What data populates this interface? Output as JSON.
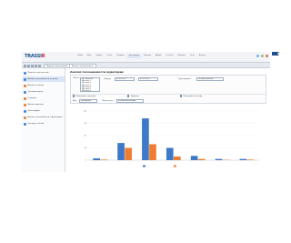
{
  "app": {
    "logo_main": "TRASSI",
    "logo_accent": "R",
    "menu": [
      "Файл",
      "Вид",
      "Сервис",
      "Окна",
      "Справка",
      "Настройки",
      "Каналы",
      "Архив",
      "Отчёты",
      "Помощь",
      "Сеть",
      "Выход"
    ],
    "menu_selected_index": 5
  },
  "tabs": {
    "items": [
      "Подсчёт посетителей",
      "Анализ посещаемости"
    ],
    "active_index": 1
  },
  "sidebar": {
    "items": [
      {
        "label": "Подсчёт посетителей",
        "color": "#3c7dd9"
      },
      {
        "label": "Анализ посещаемости по дням",
        "color": "#3c7dd9"
      },
      {
        "label": "Анализ по часам",
        "color": "#e07b2a"
      },
      {
        "label": "Тепловая карта",
        "color": "#3c7dd9"
      },
      {
        "label": "Очереди",
        "color": "#e07b2a"
      },
      {
        "label": "Анализ времени",
        "color": "#e07b2a"
      },
      {
        "label": "Демография",
        "color": "#3c7dd9"
      },
      {
        "label": "Анализ посещаемости с фильтрами",
        "color": "#e07b2a"
      },
      {
        "label": "Экспорт отчётов",
        "color": "#3c7dd9"
      }
    ],
    "active_index": 1
  },
  "page": {
    "title": "Анализ посещаемости аудитории"
  },
  "filters": {
    "objects_label": "Объекты",
    "objects_list": [
      "Все объекты",
      "Магазин 1",
      "Магазин 2",
      "Магазин 3",
      "Магазин 4",
      "Магазин 5",
      "Магазин 6",
      "Магазин 7"
    ],
    "period_label": "Период",
    "date_from": "01.03.2021",
    "date_to": "31.03.2021",
    "group_label": "Группировка",
    "group_value": "По дням недели",
    "check_left": "Показывать значения",
    "check_mid": "Сравнить",
    "check_right": "Показывать легенду",
    "view_label": "Вид",
    "view_value": "Диаграмма",
    "metric_label": "Показатель",
    "metric_value": "Количество входов"
  },
  "chart_data": {
    "type": "bar",
    "title": "",
    "categories": [
      "",
      "",
      "",
      "",
      "",
      "",
      ""
    ],
    "series": [
      {
        "name": "",
        "color": "#3d78c9",
        "values": [
          1.5,
          14,
          34,
          10,
          3.5,
          1,
          1
        ]
      },
      {
        "name": "",
        "color": "#ee7d31",
        "values": [
          0.5,
          10,
          13,
          3,
          1,
          0.3,
          0.5
        ]
      }
    ],
    "ylim": [
      0,
      40
    ],
    "yticks": [
      "40",
      "30",
      "20",
      "10",
      "0"
    ],
    "xlabel": "",
    "grid": true,
    "legend": "bottom"
  }
}
